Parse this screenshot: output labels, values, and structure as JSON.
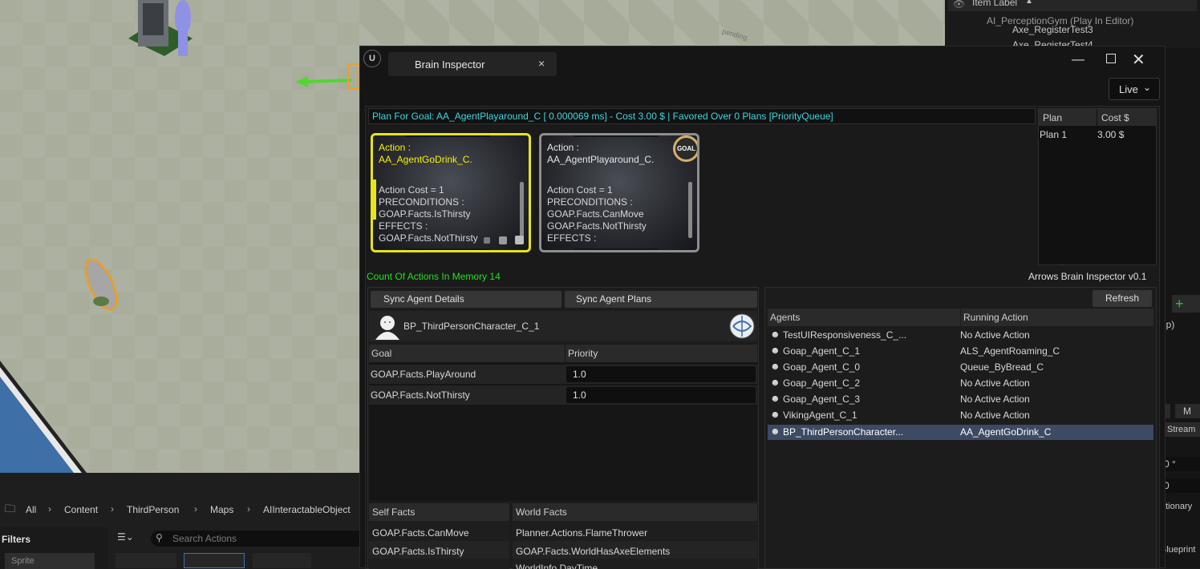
{
  "viewport": {
    "label": "pending"
  },
  "outliner": {
    "header": "Item Label",
    "items": [
      "AI_PerceptionGym (Play In Editor)",
      "Axe_RegisterTest3",
      "Axe_RegisterTest4"
    ],
    "partial_labels": [
      "np)",
      "0 °",
      "0",
      "ationary",
      "Blueprint",
      "Stream",
      "M",
      "A"
    ]
  },
  "content_browser": {
    "breadcrumb": [
      "All",
      "Content",
      "ThirdPerson",
      "Maps",
      "AIInteractableObject"
    ],
    "filters_label": "Filters",
    "search_placeholder": "Search Actions",
    "sprite_label": "Sprite"
  },
  "window": {
    "tab_title": "Brain Inspector",
    "live_label": "Live",
    "plan_summary": "Plan For Goal: AA_AgentPlayaround_C [ 0.000069 ms] - Cost 3.00 $ | Favored Over 0 Plans [PriorityQueue]",
    "plans_table": {
      "headers": [
        "Plan",
        "Cost $"
      ],
      "rows": [
        [
          "Plan 1",
          "3.00 $"
        ]
      ]
    },
    "action_cards": [
      {
        "title": "Action :",
        "name": "AA_AgentGoDrink_C.",
        "lines": [
          "Action Cost = 1",
          "PRECONDITIONS :",
          "GOAP.Facts.IsThirsty",
          "EFFECTS :",
          "GOAP.Facts.NotThirsty"
        ]
      },
      {
        "title": "Action :",
        "name": "AA_AgentPlayaround_C.",
        "lines": [
          "Action Cost = 1",
          "PRECONDITIONS :",
          "GOAP.Facts.CanMove",
          "GOAP.Facts.NotThirsty",
          "EFFECTS :"
        ],
        "badge": "GOAL"
      }
    ],
    "actions_in_memory": "Count Of Actions In Memory 14",
    "version": "Arrows Brain Inspector v0.1",
    "sync_details_label": "Sync Agent Details",
    "sync_plans_label": "Sync Agent Plans",
    "selected_agent": "BP_ThirdPersonCharacter_C_1",
    "goals_table": {
      "headers": [
        "Goal",
        "Priority"
      ],
      "rows": [
        [
          "GOAP.Facts.PlayAround",
          "1.0"
        ],
        [
          "GOAP.Facts.NotThirsty",
          "1.0"
        ]
      ]
    },
    "self_facts": {
      "header": "Self Facts",
      "items": [
        "GOAP.Facts.CanMove",
        "GOAP.Facts.IsThirsty"
      ]
    },
    "world_facts": {
      "header": "World Facts",
      "items": [
        "Planner.Actions.FlameThrower",
        "GOAP.Facts.WorldHasAxeElements",
        "WorldInfo.DayTime"
      ]
    },
    "refresh_label": "Refresh",
    "agents_table": {
      "headers": [
        "Agents",
        "Running Action"
      ],
      "rows": [
        [
          "TestUIResponsiveness_C_...",
          "No Active Action"
        ],
        [
          "Goap_Agent_C_1",
          "ALS_AgentRoaming_C"
        ],
        [
          "Goap_Agent_C_0",
          "Queue_ByBread_C"
        ],
        [
          "Goap_Agent_C_2",
          "No Active Action"
        ],
        [
          "Goap_Agent_C_3",
          "No Active Action"
        ],
        [
          "VikingAgent_C_1",
          "No Active Action"
        ],
        [
          "BP_ThirdPersonCharacter...",
          "AA_AgentGoDrink_C"
        ]
      ],
      "selected_index": 6
    }
  },
  "colors": {
    "accent_cyan": "#3fd6df",
    "accent_green": "#1fe21f",
    "card_selected_border": "#e7e41a",
    "card_selected_text": "#f5f10b",
    "selection_row": "#3c4a63"
  }
}
